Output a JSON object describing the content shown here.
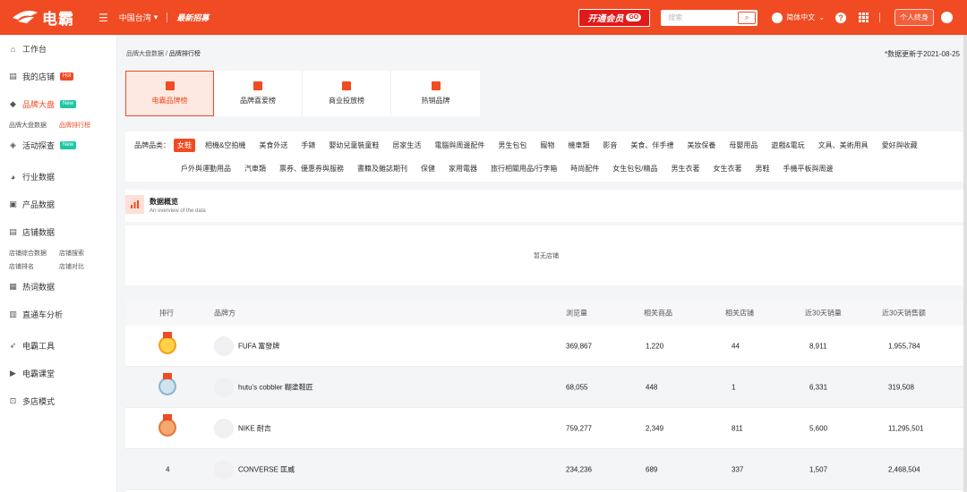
{
  "topbar": {
    "logo_text": "电霸",
    "region": "中国台湾",
    "promo": "最新招募",
    "vip_label": "开通会员",
    "vip_badge": "GO",
    "search_placeholder": "搜索",
    "language": "简体中文",
    "personal": "个人终身",
    "accent": "#f04b23"
  },
  "sidebar": {
    "items": [
      {
        "label": "工作台",
        "icon": "home-icon"
      },
      {
        "label": "我的店铺",
        "icon": "store-icon",
        "tag": "Hot"
      },
      {
        "label": "品牌大盘",
        "icon": "diamond-icon",
        "tag": "New"
      },
      {
        "label": "活动探查",
        "icon": "tag-icon",
        "tag": "New"
      },
      {
        "label": "行业数据",
        "icon": "pie-icon"
      },
      {
        "label": "产品数据",
        "icon": "box-icon"
      },
      {
        "label": "店铺数据",
        "icon": "store-icon"
      },
      {
        "label": "热词数据",
        "icon": "doc-icon"
      },
      {
        "label": "直通车分析",
        "icon": "chart-icon"
      },
      {
        "label": "电霸工具",
        "icon": "rocket-icon"
      },
      {
        "label": "电霸课堂",
        "icon": "play-icon"
      },
      {
        "label": "多店模式",
        "icon": "cart-icon"
      }
    ],
    "brand_sub": [
      "品牌大盘数据",
      "品牌排行榜"
    ],
    "store_sub": [
      "店铺综合数据",
      "店铺搜索",
      "店铺排名",
      "店铺对比"
    ]
  },
  "main": {
    "breadcrumb_parent": "品牌大盘数据 /",
    "breadcrumb_current": "品牌排行榜",
    "updated": "*数据更新于2021-08-25",
    "cards": [
      "电霸品牌榜",
      "品牌喜爱榜",
      "商业投放榜",
      "热销品牌"
    ],
    "category_label": "品牌品类：",
    "categories_row1": [
      "女鞋",
      "相機&空拍機",
      "美食外送",
      "手錶",
      "嬰幼兒童裝童鞋",
      "居家生活",
      "電腦與周邊配件",
      "男生包包",
      "寵物",
      "機車類",
      "影音",
      "美食、伴手禮",
      "美妝保養",
      "母嬰用品",
      "遊戲&電玩",
      "文具、美術用具",
      "愛好與收藏"
    ],
    "categories_row2": [
      "戶外與運動用品",
      "汽車類",
      "票券、優惠券與服務",
      "書籍及雜誌期刊",
      "保健",
      "家用電器",
      "旅行相關用品/行李箱",
      "時尚配件",
      "女生包包/精品",
      "男生衣著",
      "女生衣著",
      "男鞋",
      "手機平板與周邊"
    ],
    "overview_title": "数据概览",
    "overview_sub": "An overview of the data",
    "empty_text": "暂无店铺",
    "table": {
      "headers": [
        "排行",
        "品牌方",
        "浏览量",
        "相关商品",
        "相关店铺",
        "近30天销量",
        "近30天销售额"
      ],
      "rows": [
        {
          "rank": "",
          "medal": "gold",
          "brand": "FUFA 富發牌",
          "views": "369,867",
          "products": "1,220",
          "stores": "44",
          "sales30": "8,911",
          "revenue30": "1,955,784"
        },
        {
          "rank": "",
          "medal": "silver",
          "brand": "hutu's cobbler 糊塗鞋匠",
          "views": "68,055",
          "products": "448",
          "stores": "1",
          "sales30": "6,331",
          "revenue30": "319,508"
        },
        {
          "rank": "",
          "medal": "bronze",
          "brand": "NIKE 耐吉",
          "views": "759,277",
          "products": "2,349",
          "stores": "811",
          "sales30": "5,600",
          "revenue30": "11,295,501"
        },
        {
          "rank": "4",
          "medal": "",
          "brand": "CONVERSE 匡威",
          "views": "234,236",
          "products": "689",
          "stores": "337",
          "sales30": "1,507",
          "revenue30": "2,468,504"
        }
      ]
    }
  }
}
